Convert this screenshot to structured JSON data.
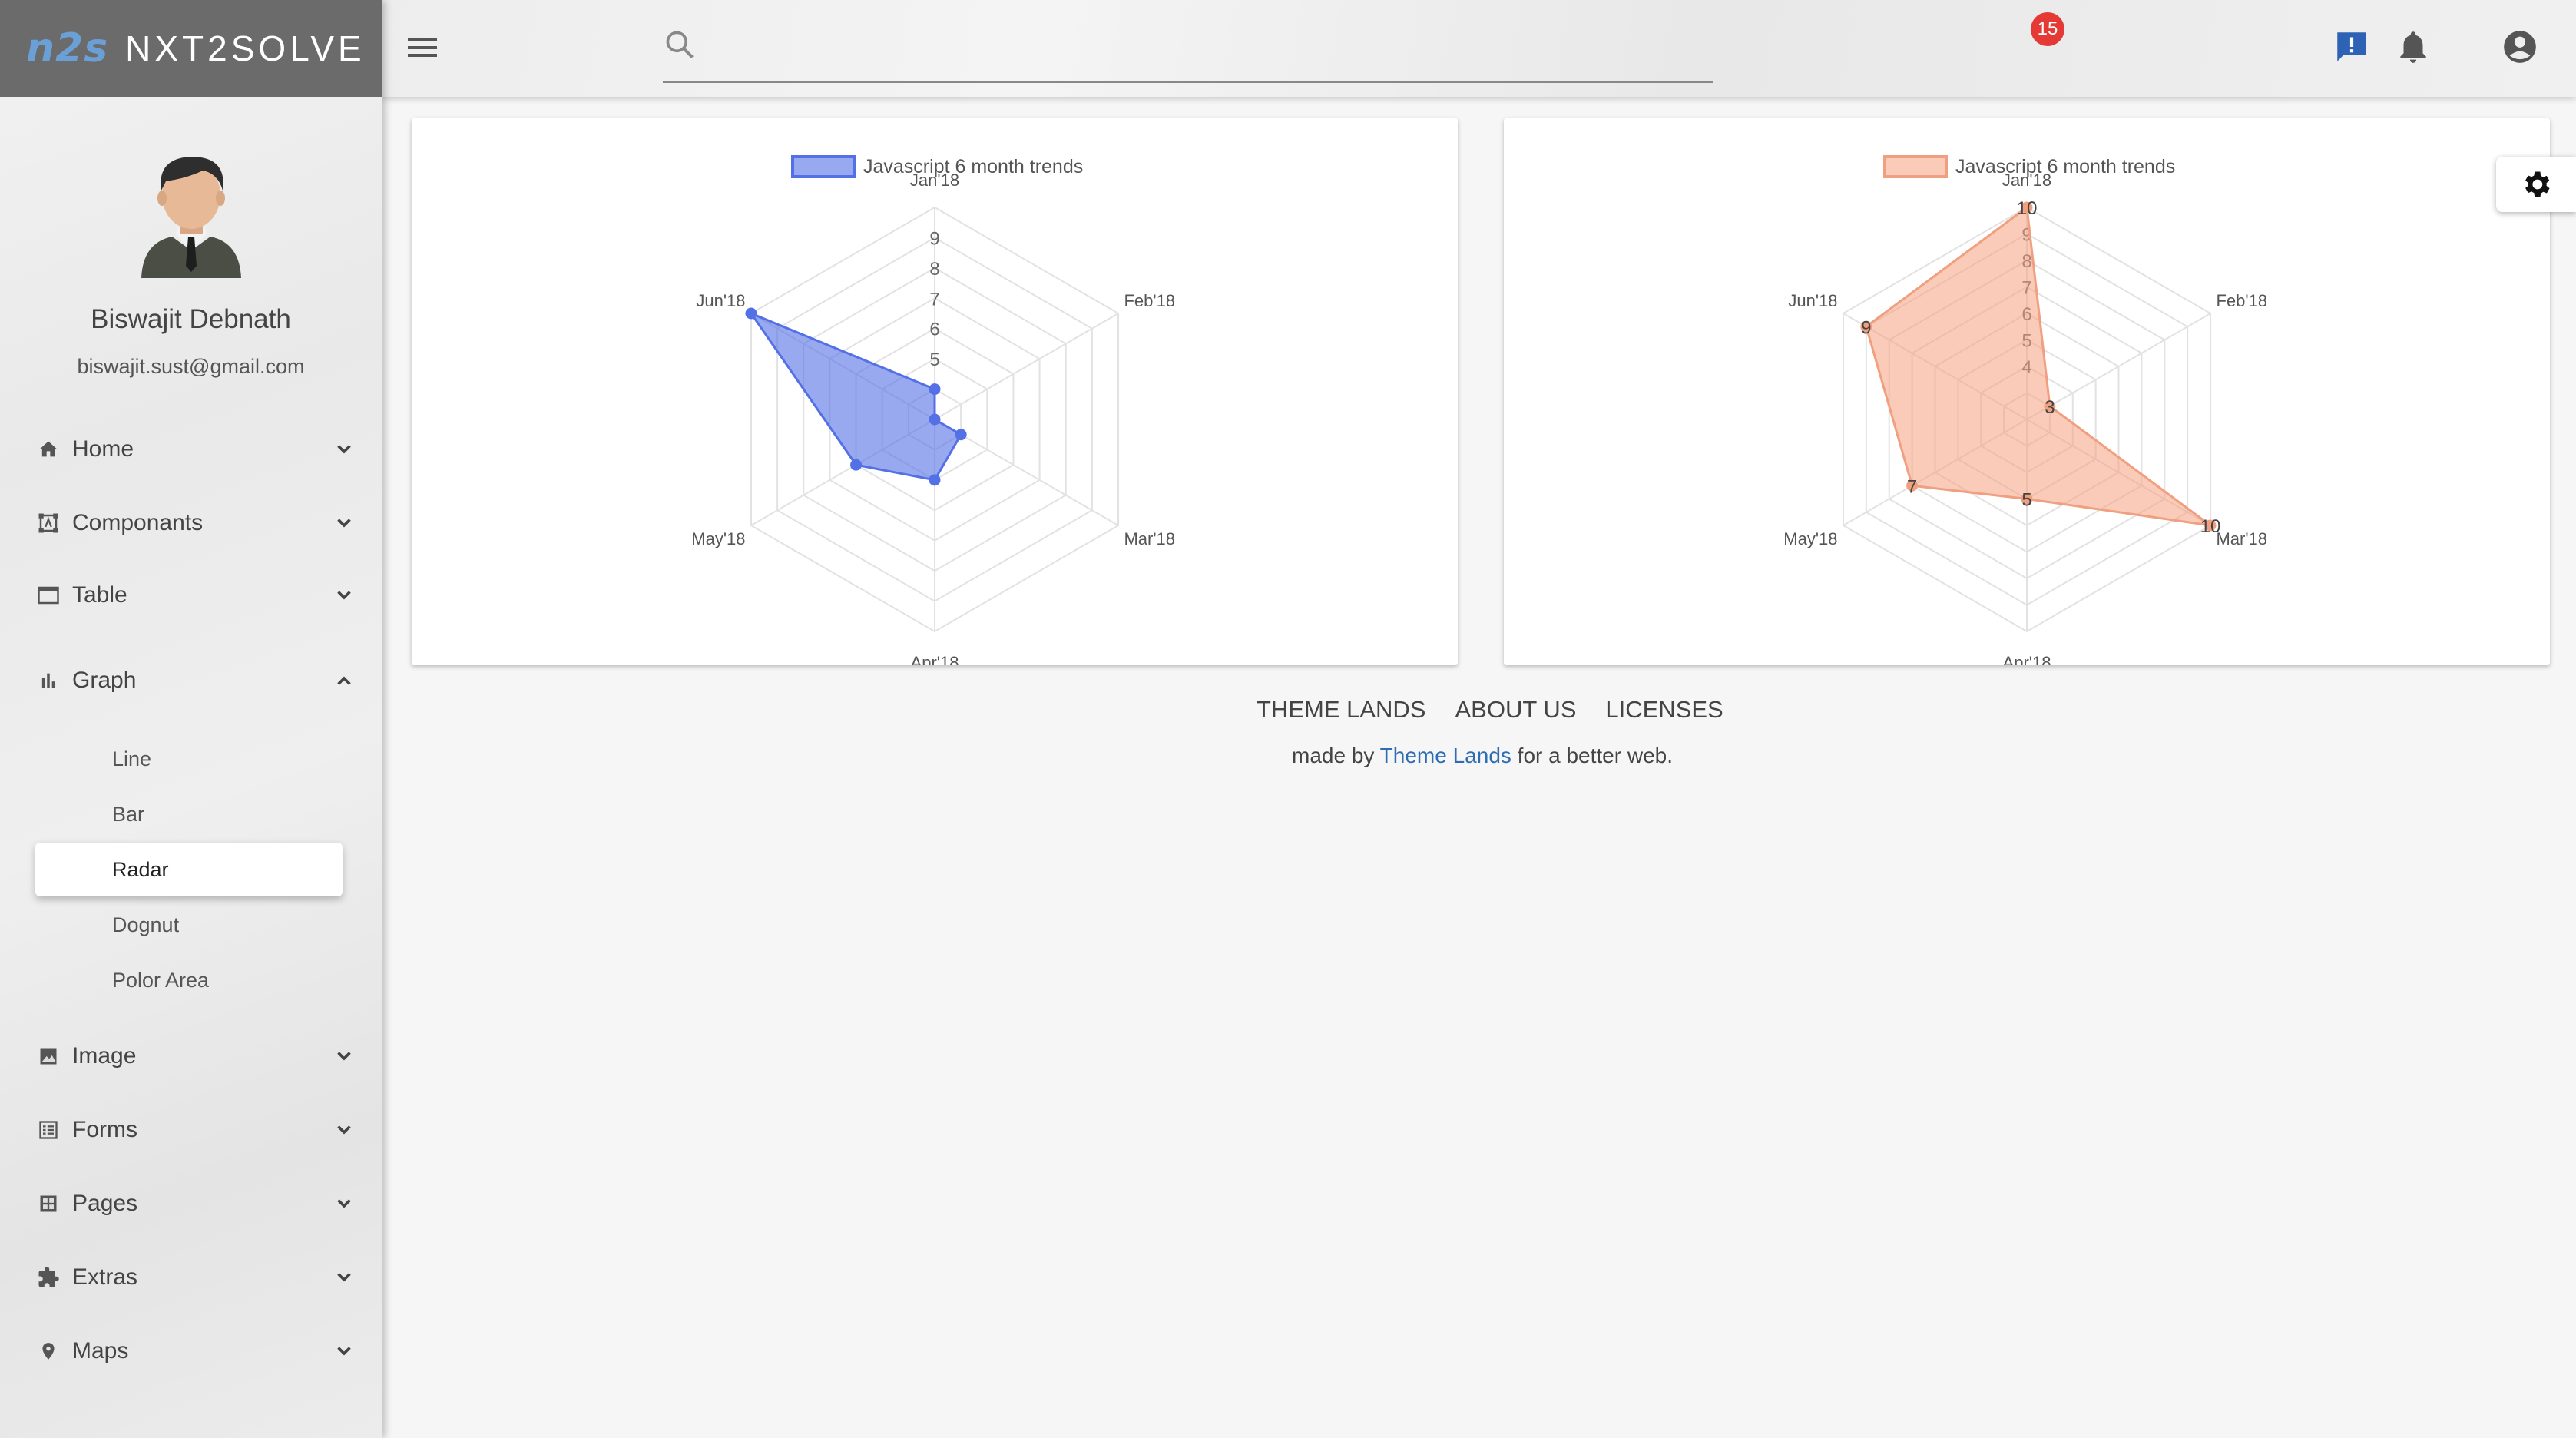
{
  "brand": {
    "logo": "n2s",
    "name": "NXT2SOLVE"
  },
  "profile": {
    "name": "Biswajit Debnath",
    "email": "biswajit.sust@gmail.com"
  },
  "sidebar": {
    "items": [
      {
        "label": "Home",
        "icon": "home-icon"
      },
      {
        "label": "Componants",
        "icon": "components-icon"
      },
      {
        "label": "Table",
        "icon": "table-icon"
      },
      {
        "label": "Graph",
        "icon": "graph-icon",
        "expanded": true
      },
      {
        "label": "Image",
        "icon": "image-icon"
      },
      {
        "label": "Forms",
        "icon": "forms-icon"
      },
      {
        "label": "Pages",
        "icon": "pages-icon"
      },
      {
        "label": "Extras",
        "icon": "extras-icon"
      },
      {
        "label": "Maps",
        "icon": "map-pin-icon"
      }
    ],
    "graph_sub": [
      "Line",
      "Bar",
      "Radar",
      "Dognut",
      "Polor Area"
    ],
    "active_sub": "Radar"
  },
  "header": {
    "search_placeholder": "",
    "notification_count": "15"
  },
  "chart_data": [
    {
      "type": "radar",
      "legend": "Javascript 6 month trends",
      "labels": [
        "Jan'18",
        "Feb'18",
        "Mar'18",
        "Apr'18",
        "May'18",
        "Jun'18"
      ],
      "values": [
        4,
        3,
        4,
        5,
        6,
        10
      ],
      "r_min": 3,
      "r_max": 10,
      "tick_labels": [
        "5",
        "6",
        "7",
        "8",
        "9"
      ],
      "show_data_labels": false,
      "color": "#5470e6",
      "fill": "rgba(84,112,230,0.6)"
    },
    {
      "type": "radar",
      "legend": "Javascript 6 month trends",
      "labels": [
        "Jan'18",
        "Feb'18",
        "Mar'18",
        "Apr'18",
        "May'18",
        "Jun'18"
      ],
      "values": [
        10,
        3,
        10,
        5,
        7,
        9
      ],
      "r_min": 2,
      "r_max": 10,
      "tick_labels": [
        "4",
        "5",
        "6",
        "7",
        "8",
        "9",
        "10"
      ],
      "show_data_labels": true,
      "color": "#f0a080",
      "fill": "rgba(245,160,125,0.55)"
    }
  ],
  "footer": {
    "links": [
      "THEME LANDS",
      "ABOUT US",
      "LICENSES"
    ],
    "made_by_prefix": "made by ",
    "made_by_link": "Theme Lands",
    "made_by_suffix": " for a better web."
  }
}
